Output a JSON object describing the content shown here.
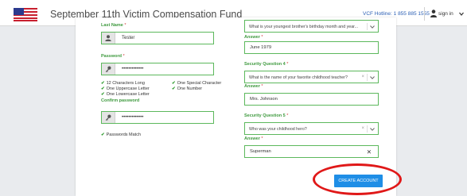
{
  "header": {
    "app_title": "September 11th Victim Compensation Fund",
    "hotline": "VCF Hotline: 1 855 885 1555",
    "signin_label": "sign in"
  },
  "form": {
    "last_name": {
      "label": "Last Name",
      "required_mark": "*",
      "value": "Tester"
    },
    "password": {
      "label": "Password",
      "required_mark": "*",
      "value": "•••••••••••••"
    },
    "rules": [
      "12 Characters Long",
      "One Special Character",
      "One Uppercase Letter",
      "One Number",
      "One Lowercase Letter"
    ],
    "confirm_password": {
      "label": "Confirm password",
      "value": "•••••••••••••"
    },
    "passwords_match": "Passwords Match",
    "security_question_3": {
      "value": "What is your youngest brother's birthday month and year..."
    },
    "answer_3": {
      "label": "Answer",
      "required_mark": "*",
      "value": "June 1979"
    },
    "security_question_4": {
      "label": "Security Question 4",
      "required_mark": "*",
      "value": "What is the name of your favorite childhood teacher?"
    },
    "answer_4": {
      "label": "Answer",
      "required_mark": "*",
      "value": "Mrs. Johnson"
    },
    "security_question_5": {
      "label": "Security Question 5",
      "required_mark": "*",
      "value": "Who was your childhood hero?"
    },
    "answer_5": {
      "label": "Answer",
      "required_mark": "*",
      "value": "Superman"
    },
    "select_clear_glyph": "×",
    "input_clear_glyph": "✕",
    "check_glyph": "✔",
    "create_account_label": "CREATE ACCOUNT"
  },
  "colors": {
    "accent_green": "#5cb85c",
    "label_green": "#3f9a3f",
    "button_blue": "#1f8ee6",
    "highlight_red": "#e01818"
  },
  "icons": [
    "flag-icon",
    "person-icon",
    "caret-down-icon",
    "user-icon",
    "key-icon",
    "check-icon",
    "clear-icon"
  ]
}
